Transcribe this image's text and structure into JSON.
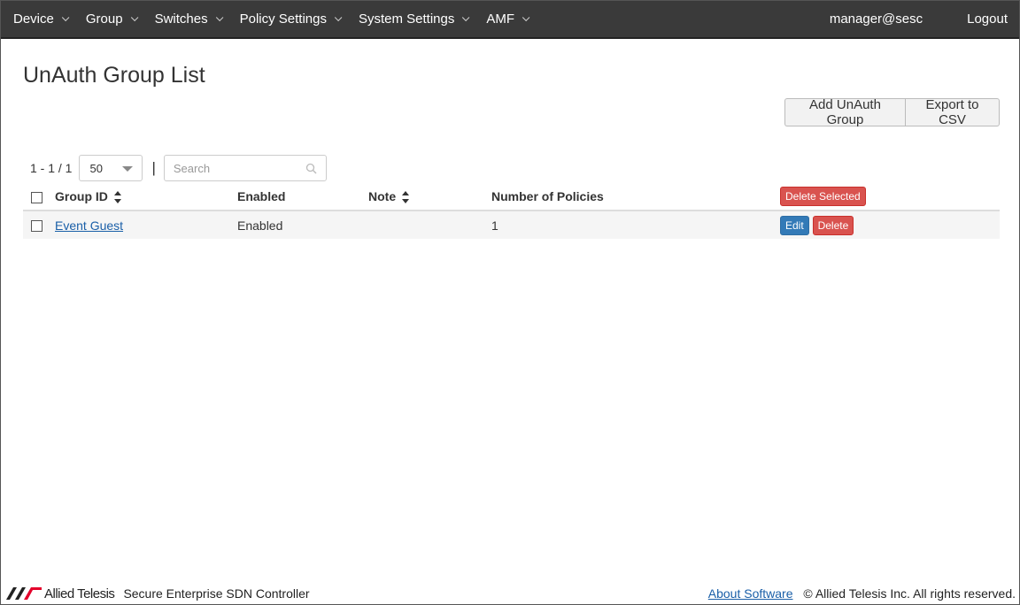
{
  "nav": {
    "items": [
      {
        "label": "Device"
      },
      {
        "label": "Group"
      },
      {
        "label": "Switches"
      },
      {
        "label": "Policy Settings"
      },
      {
        "label": "System Settings"
      },
      {
        "label": "AMF"
      }
    ],
    "user": "manager@sesc",
    "logout": "Logout"
  },
  "page": {
    "title": "UnAuth Group List",
    "add_button": "Add UnAuth Group",
    "export_button": "Export to CSV"
  },
  "toolbar": {
    "pager": "1 - 1 / 1",
    "page_size": "50",
    "separator": "|",
    "search_placeholder": "Search"
  },
  "table": {
    "headers": {
      "group_id": "Group ID",
      "enabled": "Enabled",
      "note": "Note",
      "policies": "Number of Policies",
      "delete_selected": "Delete Selected"
    },
    "rows": [
      {
        "group_id": "Event Guest",
        "enabled": "Enabled",
        "note": "",
        "policies": "1",
        "edit": "Edit",
        "delete": "Delete"
      }
    ]
  },
  "footer": {
    "brand": "Allied Telesis",
    "product": "Secure Enterprise SDN Controller",
    "about": "About Software",
    "copyright": "© Allied Telesis Inc. All rights reserved."
  },
  "colors": {
    "navbar_bg": "#3a3a3a",
    "danger": "#d9534f",
    "primary": "#337ab7",
    "link": "#1a5fa8",
    "logo_red": "#e4002b"
  }
}
